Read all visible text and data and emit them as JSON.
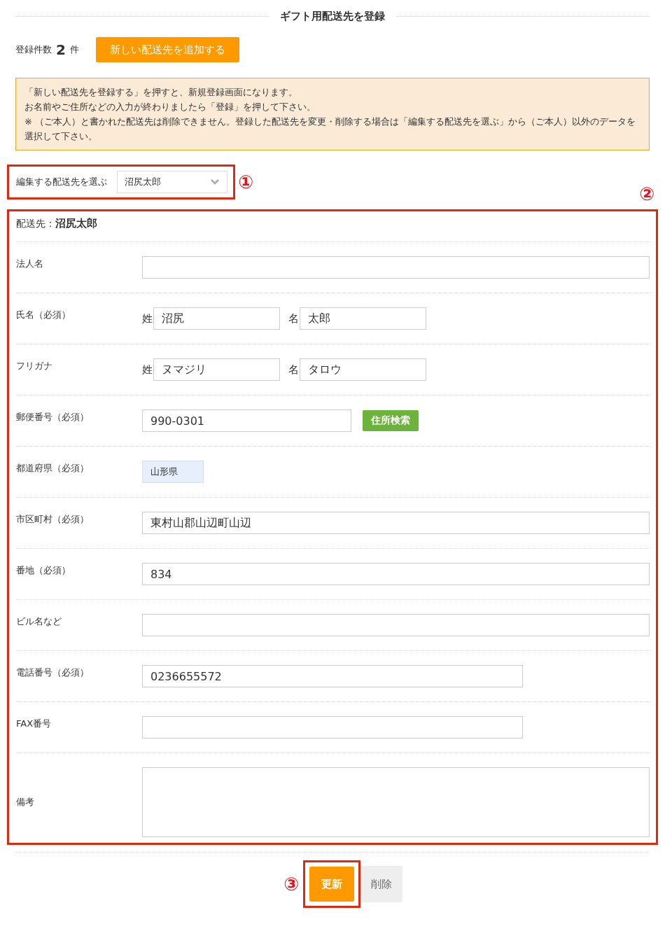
{
  "title": "ギフト用配送先を登録",
  "count": {
    "label": "登録件数",
    "value": "2",
    "unit": "件"
  },
  "add_button": "新しい配送先を追加する",
  "notice": [
    "「新しい配送先を登録する」を押すと、新規登録画面になります。",
    "お名前やご住所などの入力が終わりましたら「登録」を押して下さい。",
    "※ （ご本人）と書かれた配送先は削除できません。登録した配送先を変更・削除する場合は「編集する配送先を選ぶ」から（ご本人）以外のデータを選択して下さい。"
  ],
  "selector": {
    "label": "編集する配送先を選ぶ",
    "value": "沼尻太郎",
    "marker": "①"
  },
  "form": {
    "marker": "②",
    "heading_label": "配送先：",
    "heading_name": "沼尻太郎",
    "fields": [
      {
        "kind": "text",
        "label": "法人名"
      },
      {
        "kind": "name",
        "label": "氏名（必須）",
        "parts": [
          {
            "label": "姓",
            "value": "沼尻"
          },
          {
            "label": "名",
            "value": "太郎"
          }
        ]
      },
      {
        "kind": "name",
        "label": "フリガナ",
        "parts": [
          {
            "label": "姓",
            "value": "ヌマジリ"
          },
          {
            "label": "名",
            "value": "タロウ"
          }
        ]
      },
      {
        "kind": "zip",
        "label": "郵便番号（必須）",
        "value": "990-0301",
        "button": "住所検索"
      },
      {
        "kind": "static",
        "label": "都道府県（必須）",
        "value": "山形県"
      },
      {
        "kind": "text",
        "label": "市区町村（必須）",
        "value": "東村山郡山辺町山辺"
      },
      {
        "kind": "text",
        "label": "番地（必須）",
        "value": "834"
      },
      {
        "kind": "text",
        "label": "ビル名など"
      },
      {
        "kind": "short",
        "label": "電話番号（必須）",
        "value": "0236655572"
      },
      {
        "kind": "short",
        "label": "FAX番号"
      },
      {
        "kind": "textarea",
        "label": "備考"
      }
    ]
  },
  "actions": {
    "marker": "③",
    "update": "更新",
    "delete": "削除"
  }
}
